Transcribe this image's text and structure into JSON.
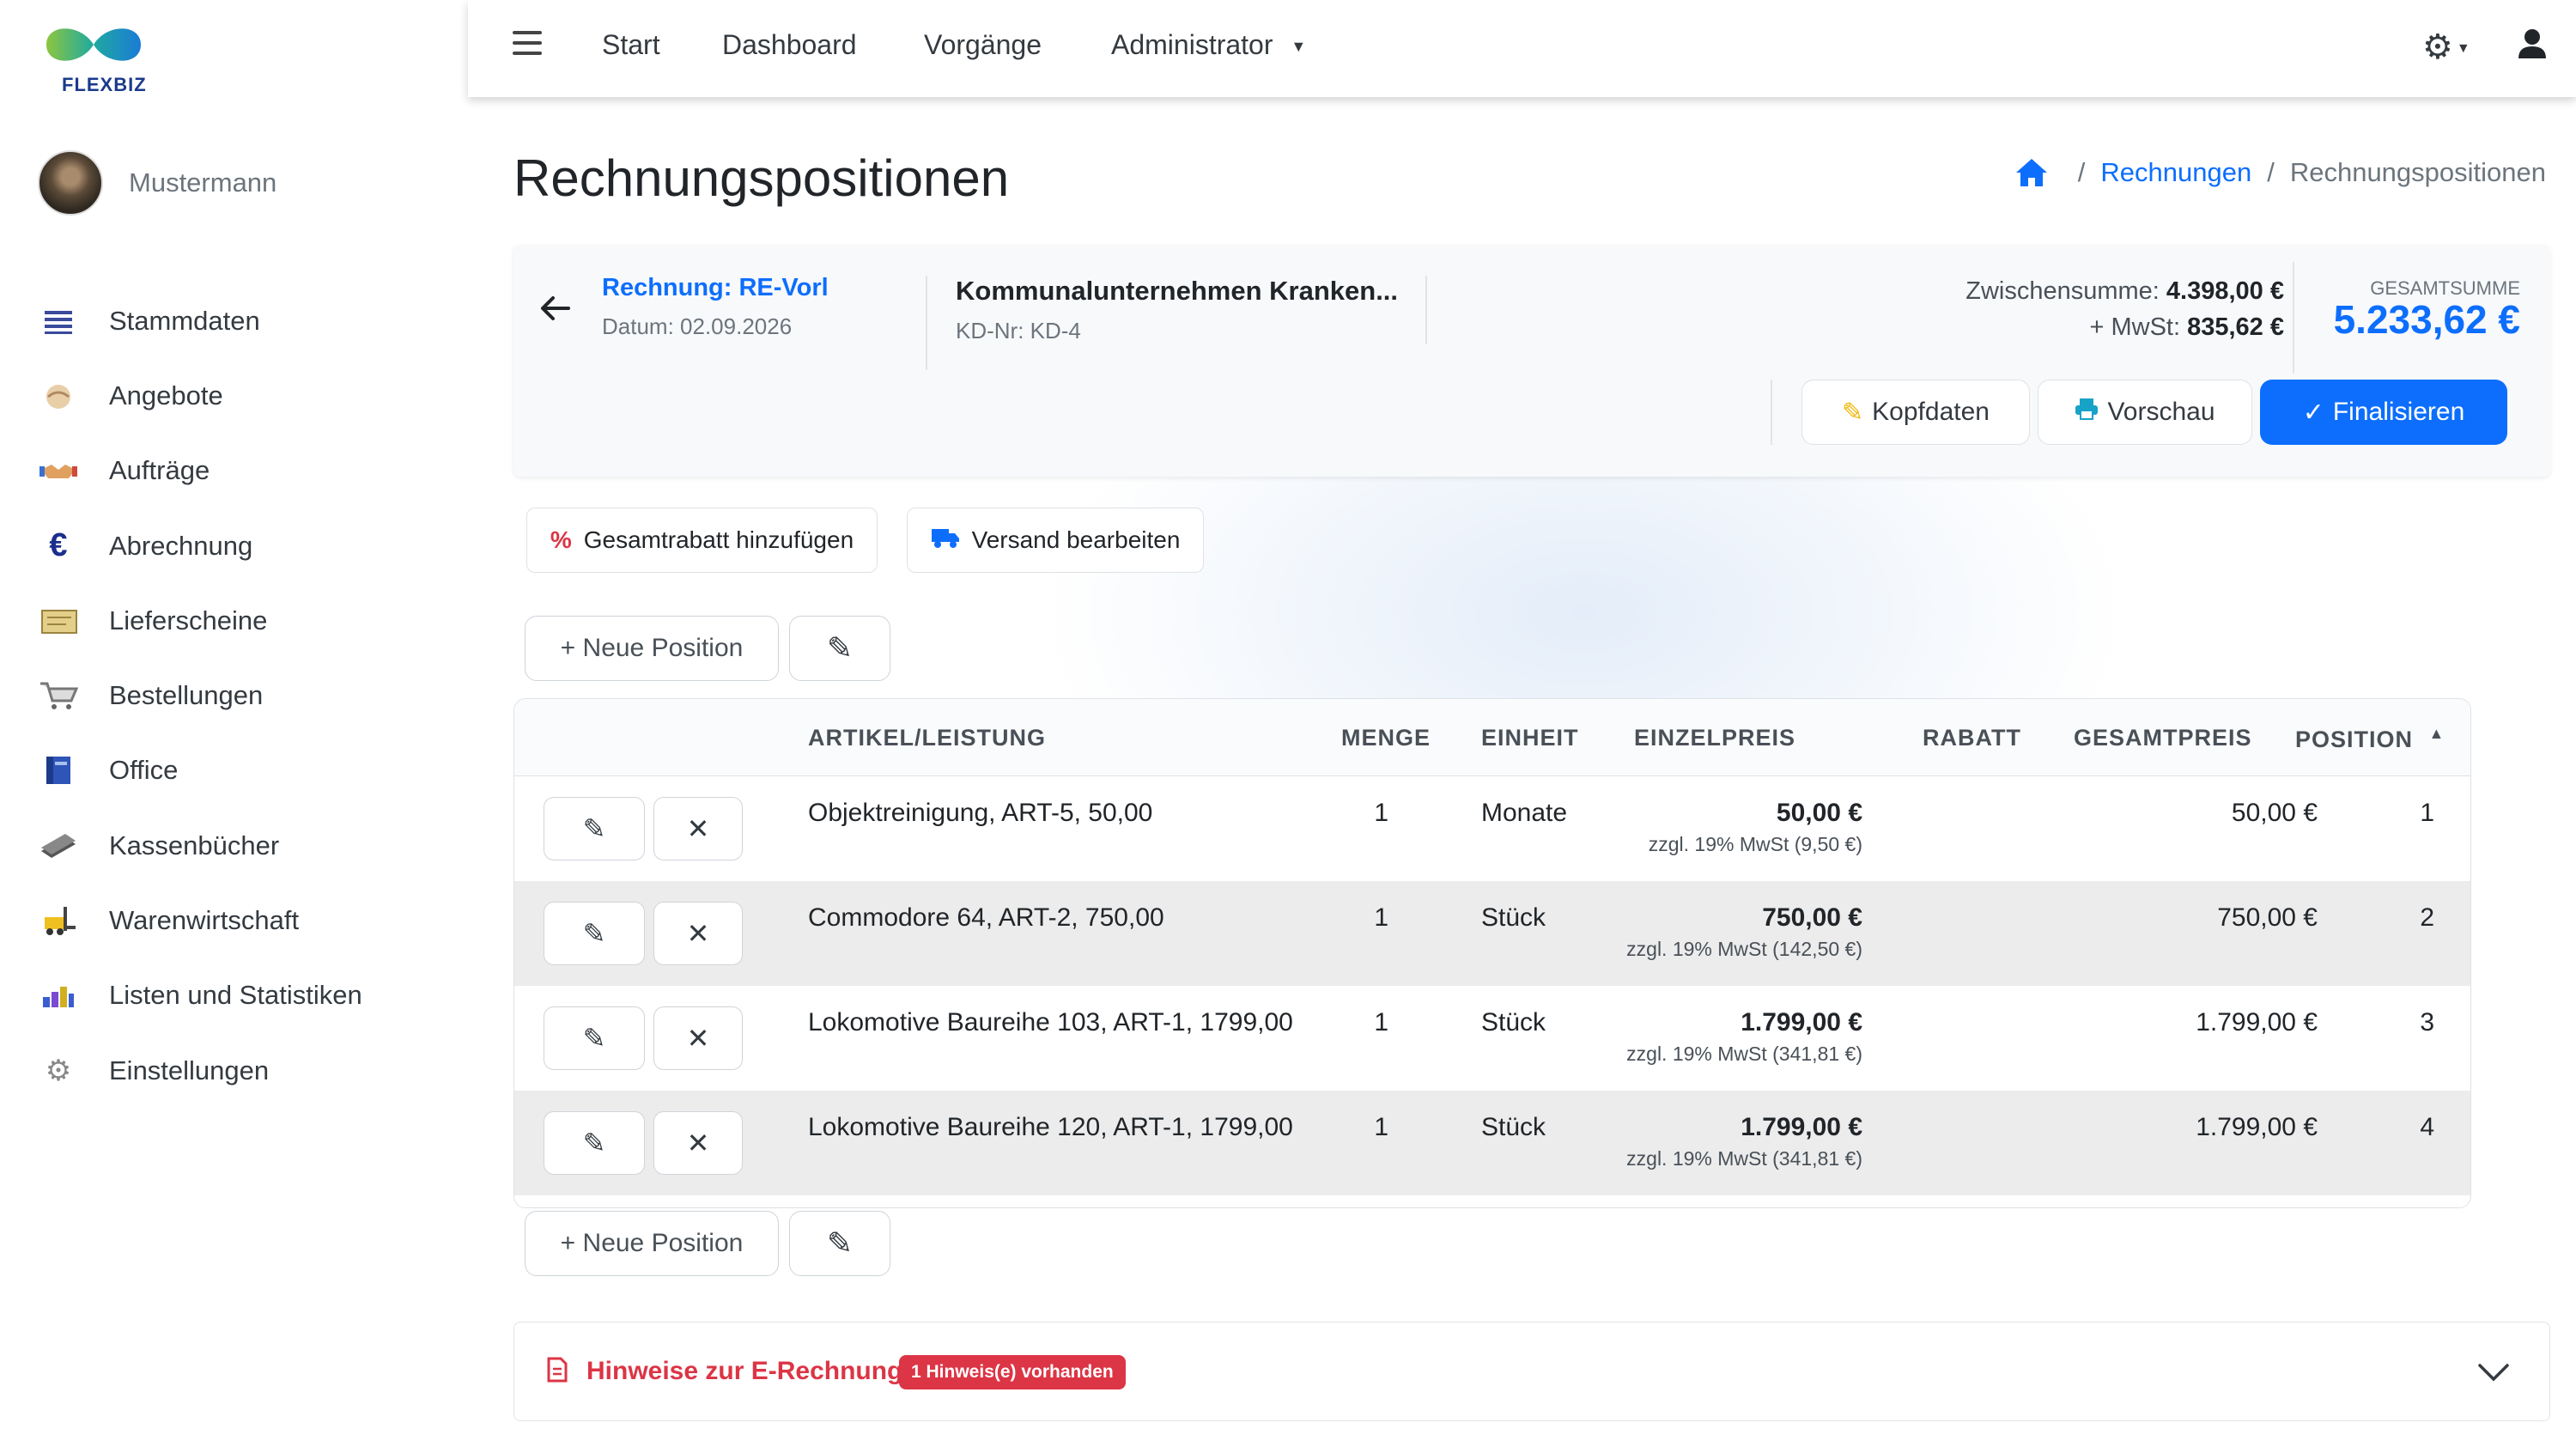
{
  "brand": {
    "name": "FLEXBIZ"
  },
  "user": {
    "name": "Mustermann"
  },
  "sidebar": {
    "items": [
      {
        "label": "Stammdaten",
        "icon": "list-icon"
      },
      {
        "label": "Angebote",
        "icon": "handshake-icon"
      },
      {
        "label": "Aufträge",
        "icon": "deal-icon"
      },
      {
        "label": "Abrechnung",
        "icon": "euro-icon"
      },
      {
        "label": "Lieferscheine",
        "icon": "delivery-note-icon"
      },
      {
        "label": "Bestellungen",
        "icon": "cart-icon"
      },
      {
        "label": "Office",
        "icon": "book-icon"
      },
      {
        "label": "Kassenbücher",
        "icon": "cash-book-icon"
      },
      {
        "label": "Warenwirtschaft",
        "icon": "forklift-icon"
      },
      {
        "label": "Listen und Statistiken",
        "icon": "bar-chart-icon"
      },
      {
        "label": "Einstellungen",
        "icon": "gear-icon"
      }
    ]
  },
  "topbar": {
    "nav": [
      "Start",
      "Dashboard",
      "Vorgänge",
      "Administrator"
    ]
  },
  "page": {
    "title": "Rechnungspositionen",
    "breadcrumb": {
      "link": "Rechnungen",
      "current": "Rechnungspositionen"
    }
  },
  "invoice": {
    "number": "Rechnung: RE-Vorl",
    "date": "Datum: 02.09.2026",
    "customer": "Kommunalunternehmen Kranken...",
    "customer_nr": "KD-Nr: KD-4",
    "subtotal_label": "Zwischensumme:",
    "subtotal": "4.398,00 €",
    "tax_label": "+ MwSt:",
    "tax": "835,62 €",
    "total_label": "GESAMTSUMME",
    "total": "5.233,62 €"
  },
  "header_buttons": {
    "kopfdaten": "Kopfdaten",
    "vorschau": "Vorschau",
    "finalisieren": "Finalisieren"
  },
  "actions": {
    "discount": "Gesamtrabatt hinzufügen",
    "shipping": "Versand bearbeiten",
    "new_position": "+ Neue Position"
  },
  "table": {
    "columns": [
      "ARTIKEL/LEISTUNG",
      "MENGE",
      "EINHEIT",
      "EINZELPREIS",
      "RABATT",
      "GESAMTPREIS",
      "POSITION"
    ],
    "rows": [
      {
        "article": "Objektreinigung, ART-5, 50,00",
        "qty": "1",
        "unit": "Monate",
        "price": "50,00 €",
        "price_note": "zzgl. 19% MwSt (9,50 €)",
        "discount": "",
        "total": "50,00 €",
        "position": "1"
      },
      {
        "article": "Commodore 64, ART-2, 750,00",
        "qty": "1",
        "unit": "Stück",
        "price": "750,00 €",
        "price_note": "zzgl. 19% MwSt (142,50 €)",
        "discount": "",
        "total": "750,00 €",
        "position": "2"
      },
      {
        "article": "Lokomotive Baureihe 103, ART-1, 1799,00",
        "qty": "1",
        "unit": "Stück",
        "price": "1.799,00 €",
        "price_note": "zzgl. 19% MwSt (341,81 €)",
        "discount": "",
        "total": "1.799,00 €",
        "position": "3"
      },
      {
        "article": "Lokomotive Baureihe 120, ART-1, 1799,00",
        "qty": "1",
        "unit": "Stück",
        "price": "1.799,00 €",
        "price_note": "zzgl. 19% MwSt (341,81 €)",
        "discount": "",
        "total": "1.799,00 €",
        "position": "4"
      }
    ]
  },
  "einvoice": {
    "title": "Hinweise zur E-Rechnung",
    "badge": "1 Hinweis(e) vorhanden"
  },
  "colors": {
    "primary": "#0d6efd",
    "danger": "#dc3545",
    "row_alt": "#ececec"
  }
}
